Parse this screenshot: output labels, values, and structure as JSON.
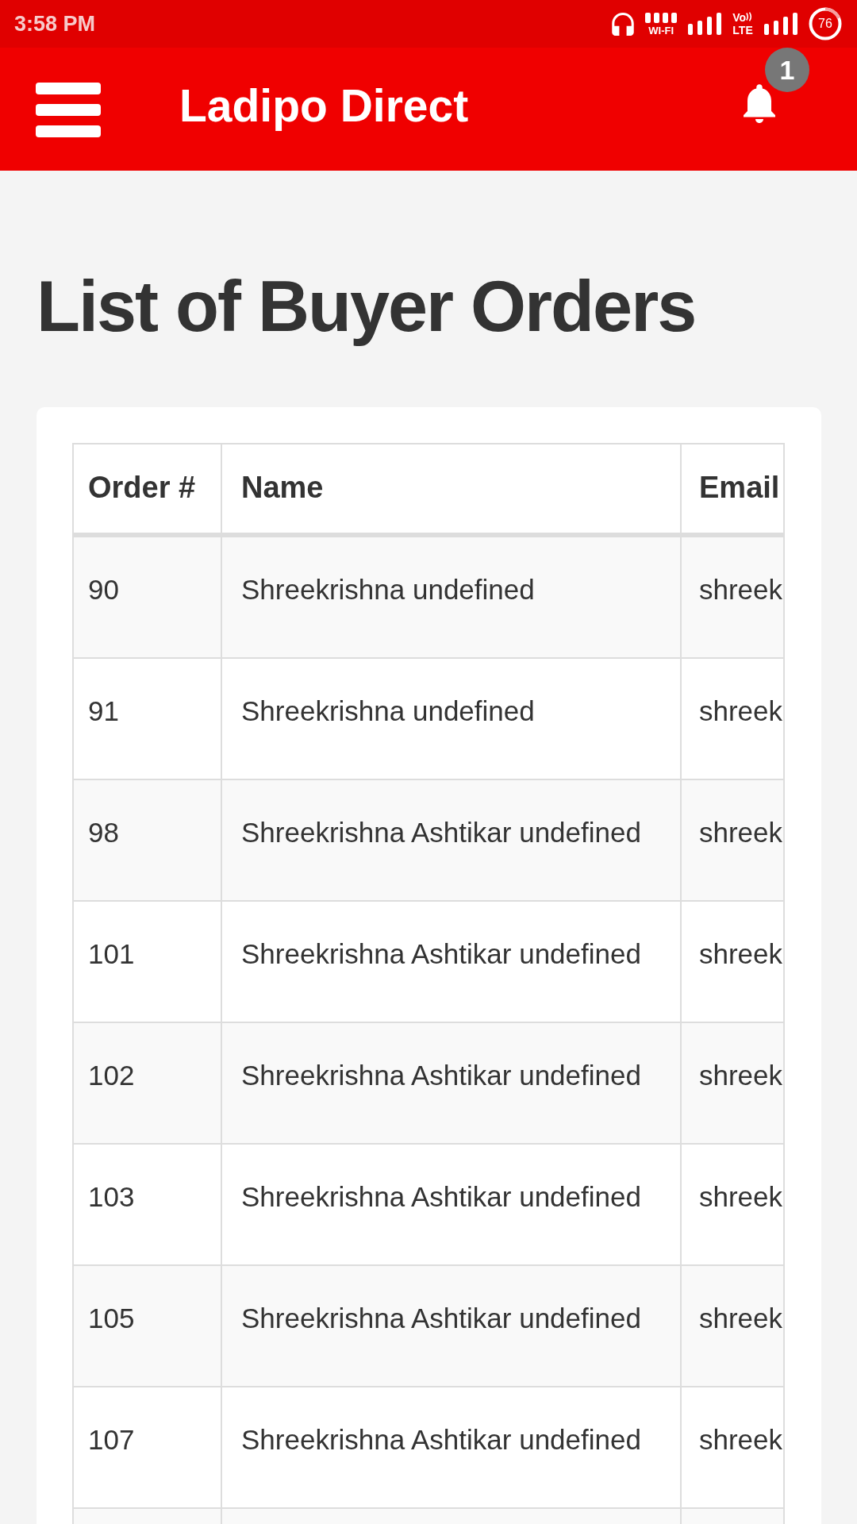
{
  "status_bar": {
    "time": "3:58 PM",
    "wifi_label": "WI-FI",
    "network_top": "Vo",
    "network_bottom": "LTE",
    "battery": "76"
  },
  "app_bar": {
    "title": "Ladipo Direct",
    "notification_count": "1"
  },
  "page": {
    "heading": "List of Buyer Orders"
  },
  "table": {
    "columns": [
      "Order #",
      "Name",
      "Email"
    ],
    "rows": [
      [
        "90",
        "Shreekrishna undefined",
        "shreek"
      ],
      [
        "91",
        "Shreekrishna undefined",
        "shreek"
      ],
      [
        "98",
        "Shreekrishna Ashtikar undefined",
        "shreek"
      ],
      [
        "101",
        "Shreekrishna Ashtikar undefined",
        "shreek"
      ],
      [
        "102",
        "Shreekrishna Ashtikar undefined",
        "shreek"
      ],
      [
        "103",
        "Shreekrishna Ashtikar undefined",
        "shreek"
      ],
      [
        "105",
        "Shreekrishna Ashtikar undefined",
        "shreek"
      ],
      [
        "107",
        "Shreekrishna Ashtikar undefined",
        "shreek"
      ]
    ]
  }
}
